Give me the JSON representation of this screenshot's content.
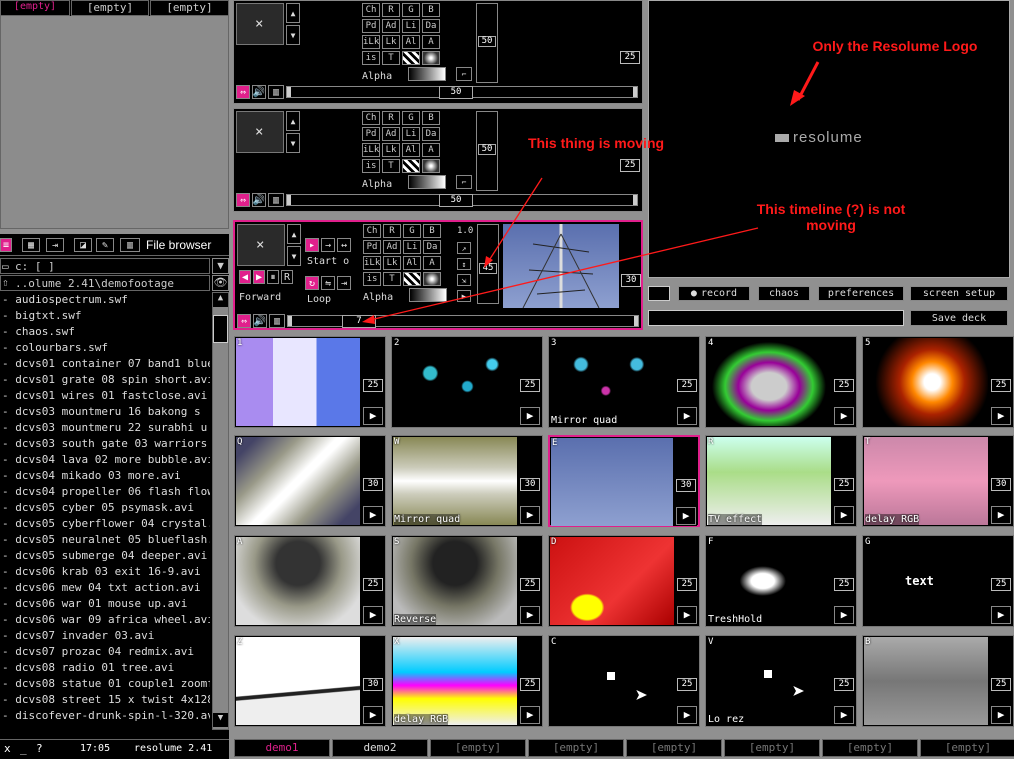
{
  "top_left": {
    "tab1": "[empty]",
    "tab2": "[empty]",
    "tab3": "[empty]"
  },
  "browser": {
    "title": "File browser",
    "drive": "c: [ ]",
    "path": "..olume 2.41\\demofootage",
    "files": [
      "- audiospectrum.swf",
      "- bigtxt.swf",
      "- chaos.swf",
      "- colourbars.swf",
      "- dcvs01 container 07 band1 blue.",
      "- dcvs01 grate 08 spin short.avi",
      "- dcvs01 wires 01 fastclose.avi",
      "- dcvs03 mountmeru 16 bakong s",
      "- dcvs03 mountmeru 22 surabhi u",
      "- dcvs03 south gate 03 warriors r",
      "- dcvs04 lava 02 more bubble.avi",
      "- dcvs04 mikado 03 more.avi",
      "- dcvs04 propeller 06 flash flower",
      "- dcvs05 cyber 05 psymask.avi",
      "- dcvs05 cyberflower 04 crystal.a",
      "- dcvs05 neuralnet 05 blueflash.a",
      "- dcvs05 submerge 04 deeper.avi",
      "- dcvs06 krab 03 exit 16-9.avi",
      "- dcvs06 mew 04 txt action.avi",
      "- dcvs06 war 01 mouse up.avi",
      "- dcvs06 war 09 africa wheel.avi",
      "- dcvs07 invader 03.avi",
      "- dcvs07 prozac 04 redmix.avi",
      "- dcvs08 radio 01 tree.avi",
      "- dcvs08 statue 01 couple1 zoomf",
      "- dcvs08 street 15 x twist 4x128bp",
      "- discofever-drunk-spin-l-320.avi"
    ]
  },
  "statusbar": {
    "close": "x",
    "min": "_",
    "help": "?",
    "time": "17:05",
    "app": "resolume 2.41"
  },
  "layers": [
    {
      "alpha_label": "Alpha",
      "opacity": "50",
      "bpm": "25",
      "slider_value": "50",
      "direction": "",
      "loop": ""
    },
    {
      "alpha_label": "Alpha",
      "opacity": "50",
      "bpm": "25",
      "slider_value": "50",
      "direction": "",
      "loop": ""
    },
    {
      "alpha_label": "Alpha",
      "opacity": "45",
      "bpm": "30",
      "slider_value": "7",
      "direction": "Forward",
      "loop": "Loop",
      "start": "Start o",
      "ratio": "1.0"
    }
  ],
  "layer_buttons": {
    "ch": "Ch",
    "r": "R",
    "g": "G",
    "b": "B",
    "pd": "Pd",
    "ad": "Ad",
    "li": "Li",
    "da": "Da",
    "ilk": "iLk",
    "lk": "Lk",
    "al": "Al",
    "a": "A",
    "is": "is",
    "t": "T",
    "close": "×"
  },
  "output": {
    "logo": "resolume"
  },
  "controls": {
    "record": "record",
    "chaos": "chaos",
    "preferences": "preferences",
    "screen_setup": "screen setup",
    "save_deck": "Save deck"
  },
  "annotations": {
    "logo": "Only the Resolume Logo",
    "moving": "This thing is moving",
    "timeline": "This timeline (?) is not moving"
  },
  "clips": [
    {
      "key": "1",
      "bpm": "25",
      "name": ""
    },
    {
      "key": "2",
      "bpm": "25",
      "name": ""
    },
    {
      "key": "3",
      "bpm": "25",
      "name": "Mirror quad"
    },
    {
      "key": "4",
      "bpm": "25",
      "name": ""
    },
    {
      "key": "5",
      "bpm": "25",
      "name": ""
    },
    {
      "key": "Q",
      "bpm": "30",
      "name": ""
    },
    {
      "key": "W",
      "bpm": "30",
      "name": "Mirror quad"
    },
    {
      "key": "E",
      "bpm": "30",
      "name": ""
    },
    {
      "key": "R",
      "bpm": "25",
      "name": "TV effect"
    },
    {
      "key": "T",
      "bpm": "30",
      "name": "delay RGB"
    },
    {
      "key": "A",
      "bpm": "25",
      "name": ""
    },
    {
      "key": "S",
      "bpm": "25",
      "name": "Reverse"
    },
    {
      "key": "D",
      "bpm": "25",
      "name": ""
    },
    {
      "key": "F",
      "bpm": "25",
      "name": "TreshHold"
    },
    {
      "key": "G",
      "bpm": "25",
      "name": "",
      "text": "text"
    },
    {
      "key": "Z",
      "bpm": "30",
      "name": ""
    },
    {
      "key": "X",
      "bpm": "25",
      "name": "delay RGB"
    },
    {
      "key": "C",
      "bpm": "25",
      "name": ""
    },
    {
      "key": "V",
      "bpm": "25",
      "name": "Lo rez"
    },
    {
      "key": "B",
      "bpm": "25",
      "name": ""
    }
  ],
  "deck_tabs": [
    "demo1",
    "demo2",
    "[empty]",
    "[empty]",
    "[empty]",
    "[empty]",
    "[empty]",
    "[empty]"
  ],
  "colors": {
    "accent": "#e0208c",
    "annotation": "#ff1a1a"
  }
}
